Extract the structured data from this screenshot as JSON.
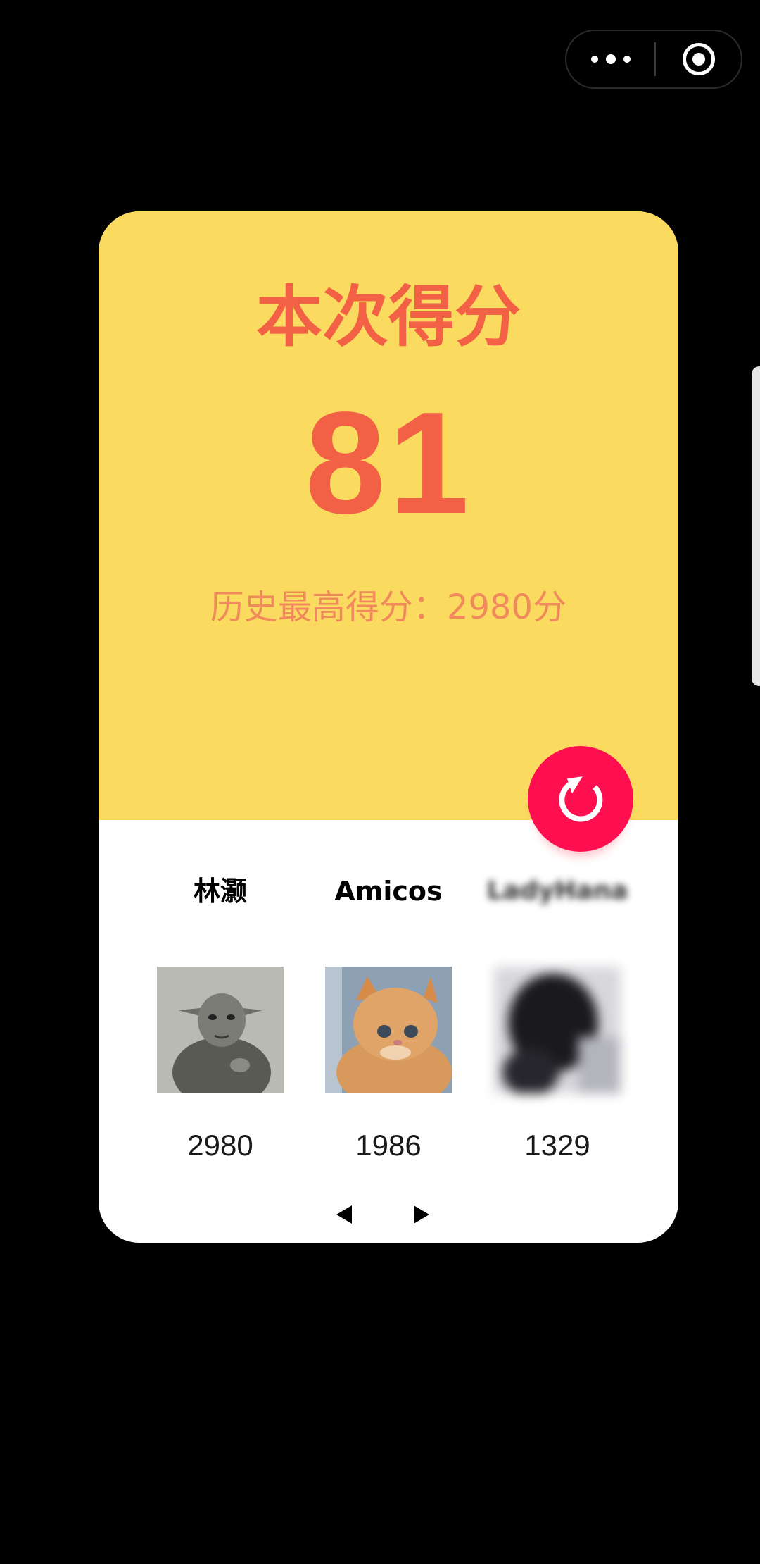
{
  "window": {
    "capsule": {
      "more_icon": "more-dots-icon",
      "close_icon": "target-circle-icon"
    }
  },
  "result": {
    "title": "本次得分",
    "score": "81",
    "best_score_text": "历史最高得分：2980分",
    "restart_icon": "restart-icon",
    "colors": {
      "card_top": "#fadb5f",
      "score_text": "#f26046",
      "restart_button": "#ff0f4f"
    }
  },
  "leaderboard": {
    "players": [
      {
        "name": "林灏",
        "avatar": "yoda-photo",
        "score": "2980"
      },
      {
        "name": "Amicos",
        "avatar": "cat-photo",
        "score": "1986"
      },
      {
        "name": "LadyHana",
        "avatar": "blurred-photo",
        "score": "1329"
      }
    ],
    "pager": {
      "prev_icon": "triangle-left-icon",
      "next_icon": "triangle-right-icon"
    }
  }
}
